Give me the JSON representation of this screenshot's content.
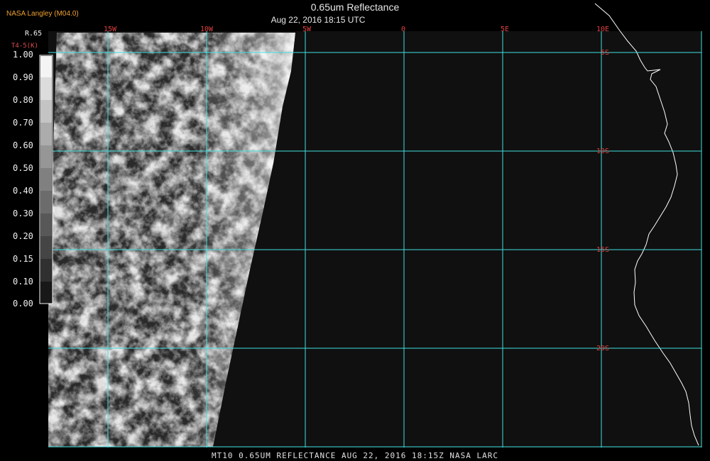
{
  "header": {
    "organization": "NASA Langley (M04.0)",
    "title": "0.65um Reflectance",
    "datetime": "Aug 22, 2016 18:15 UTC"
  },
  "legend": {
    "title": "R.65",
    "subtitle": "T4-5(K)",
    "labels": [
      "1.00",
      "0.90",
      "0.80",
      "0.70",
      "0.60",
      "0.50",
      "0.40",
      "0.30",
      "0.20",
      "0.15",
      "0.10",
      "0.00"
    ]
  },
  "map": {
    "longitude_labels": [
      "15W",
      "10W",
      "5W",
      "0",
      "5E",
      "10E"
    ],
    "latitude_labels": [
      "5S",
      "10S",
      "15S",
      "20S"
    ],
    "grid_color": "#40e0e0",
    "coast_color": "#ffffff",
    "label_color": "#e04040"
  },
  "footer": {
    "text": "MT10  0.65UM REFLECTANCE   AUG 22, 2016 18:15Z   NASA LARC"
  }
}
